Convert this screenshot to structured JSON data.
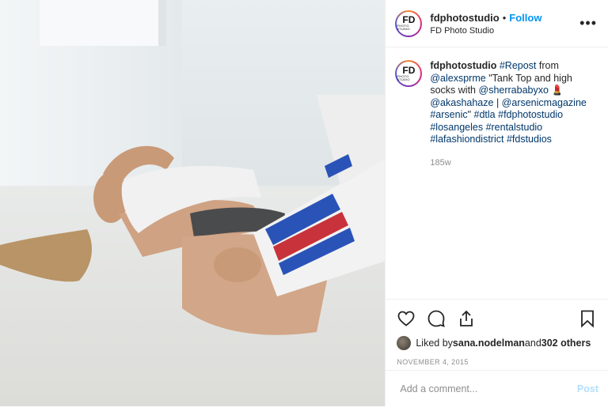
{
  "post": {
    "image_alt": "",
    "author": {
      "username": "fdphotostudio",
      "full_name": "FD Photo Studio",
      "avatar_text": "FD",
      "avatar_subtext": "PHOTO STUDIO",
      "separator": "•",
      "follow_label": "Follow",
      "more_label": "•••"
    },
    "caption": {
      "username": "fdphotostudio",
      "segments": [
        {
          "text": " ",
          "type": "plain"
        },
        {
          "text": "#Repost",
          "type": "tag"
        },
        {
          "text": " from ",
          "type": "plain"
        },
        {
          "text": "@alexsprme",
          "type": "tag"
        },
        {
          "text": " \"Tank Top and high socks with ",
          "type": "plain"
        },
        {
          "text": "@sherrababyxo",
          "type": "tag"
        },
        {
          "text": " 💄 ",
          "type": "plain"
        },
        {
          "text": "@akashahaze",
          "type": "tag"
        },
        {
          "text": " | ",
          "type": "plain"
        },
        {
          "text": "@arsenicmagazine",
          "type": "tag"
        },
        {
          "text": " ",
          "type": "plain"
        },
        {
          "text": "#arsenic",
          "type": "tag"
        },
        {
          "text": "\" ",
          "type": "plain"
        },
        {
          "text": "#dtla",
          "type": "tag"
        },
        {
          "text": " ",
          "type": "plain"
        },
        {
          "text": "#fdphotostudio",
          "type": "tag"
        },
        {
          "text": " ",
          "type": "plain"
        },
        {
          "text": "#losangeles",
          "type": "tag"
        },
        {
          "text": " ",
          "type": "plain"
        },
        {
          "text": "#rentalstudio",
          "type": "tag"
        },
        {
          "text": " ",
          "type": "plain"
        },
        {
          "text": "#lafashiondistrict",
          "type": "tag"
        },
        {
          "text": " ",
          "type": "plain"
        },
        {
          "text": "#fdstudios",
          "type": "tag"
        }
      ],
      "time_ago": "185w"
    },
    "actions": {
      "like_icon": "heart-icon",
      "comment_icon": "comment-icon",
      "share_icon": "share-icon",
      "save_icon": "bookmark-icon"
    },
    "likes": {
      "prefix": "Liked by ",
      "user": "sana.nodelman",
      "middle": " and ",
      "others": "302 others"
    },
    "date": "NOVEMBER 4, 2015",
    "comment": {
      "placeholder": "Add a comment...",
      "post_label": "Post"
    }
  },
  "colors": {
    "link": "#00376b",
    "follow": "#0095f6",
    "post_disabled": "#b2dffc",
    "muted": "#8e8e8e",
    "border": "#efefef"
  }
}
